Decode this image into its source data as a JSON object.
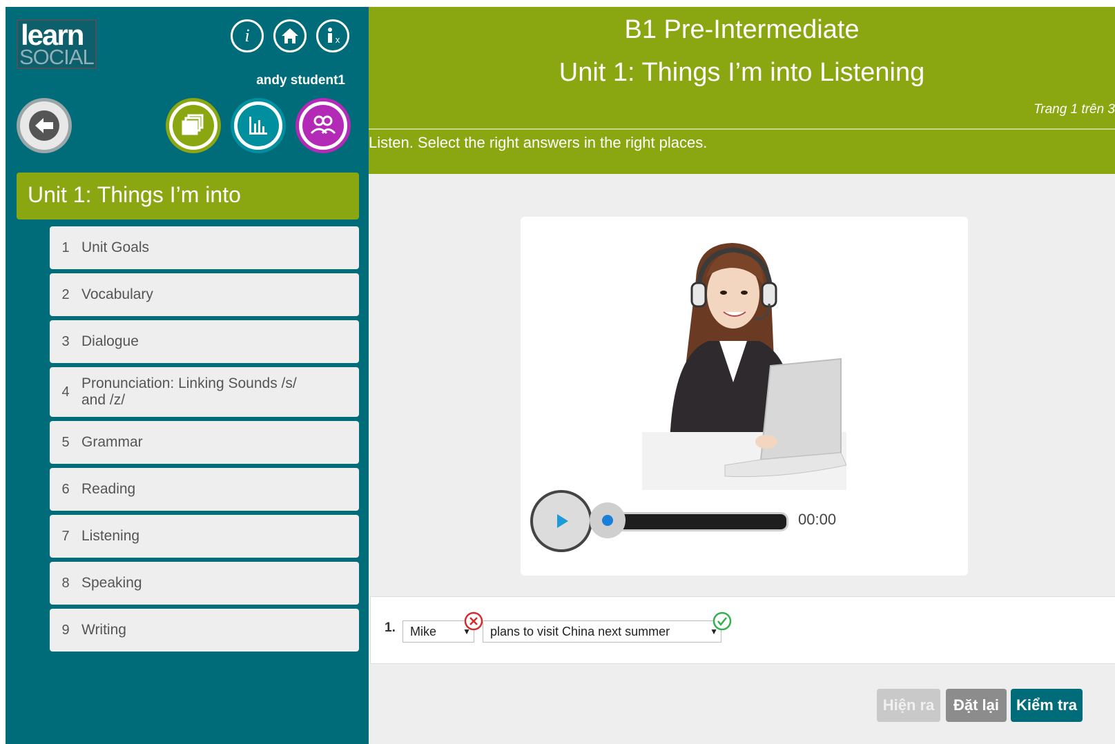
{
  "brand": {
    "line1": "learn",
    "line2": "SOCIAL"
  },
  "user": {
    "name": "andy student1"
  },
  "sidebar": {
    "unit_title": "Unit 1: Things I’m into",
    "items": [
      {
        "num": "1",
        "label": "Unit Goals"
      },
      {
        "num": "2",
        "label": "Vocabulary"
      },
      {
        "num": "3",
        "label": "Dialogue"
      },
      {
        "num": "4",
        "label": "Pronunciation: Linking Sounds /s/ and /z/"
      },
      {
        "num": "5",
        "label": "Grammar"
      },
      {
        "num": "6",
        "label": "Reading"
      },
      {
        "num": "7",
        "label": "Listening"
      },
      {
        "num": "8",
        "label": "Speaking"
      },
      {
        "num": "9",
        "label": "Writing"
      }
    ]
  },
  "header": {
    "level": "B1 Pre-Intermediate",
    "title": "Unit 1: Things I’m into Listening",
    "page_info": "Trang 1 trên 3",
    "instruction": "Listen. Select the right answers in the right places."
  },
  "player": {
    "time": "00:00",
    "progress": 0
  },
  "question": {
    "number": "1.",
    "select1": "Mike",
    "select1_status": "incorrect",
    "select2": "plans to visit China next summer",
    "select2_status": "correct"
  },
  "buttons": {
    "show": "Hiện ra",
    "reset": "Đặt lại",
    "check": "Kiểm tra"
  },
  "colors": {
    "teal": "#006c7a",
    "green": "#8aa610",
    "purple": "#b22ab5",
    "gray_bg": "#eeeeee"
  }
}
